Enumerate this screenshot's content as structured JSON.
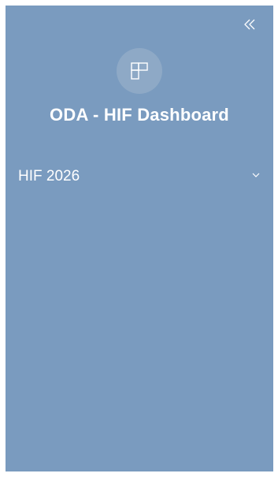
{
  "sidebar": {
    "collapse_icon": "double-chevron-left-icon",
    "logo_icon": "dashboard-layout-icon",
    "title": "ODA - HIF Dashboard",
    "items": [
      {
        "label": "HIF 2026",
        "icon": "chevron-down-icon"
      }
    ]
  },
  "colors": {
    "sidebar_bg": "#7a9bbf",
    "logo_bg": "#8ea9c6",
    "text": "#ffffff"
  }
}
